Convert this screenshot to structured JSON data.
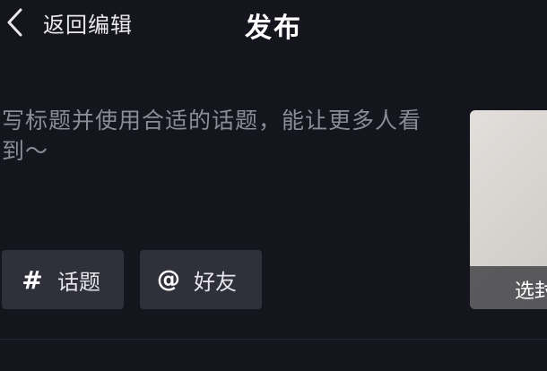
{
  "header": {
    "back_label": "返回编辑",
    "title": "发布"
  },
  "composer": {
    "placeholder": "写标题并使用合适的话题，能让更多人看到～"
  },
  "chips": {
    "topic_icon": "#",
    "topic_label": "话题",
    "friend_icon": "@",
    "friend_label": "好友"
  },
  "cover": {
    "label": "选封"
  },
  "icons": {
    "back": "chevron-left-icon"
  },
  "colors": {
    "background": "#15151d",
    "chip": "#30303a",
    "placeholder": "#8c8c96",
    "text": "#ffffff"
  }
}
